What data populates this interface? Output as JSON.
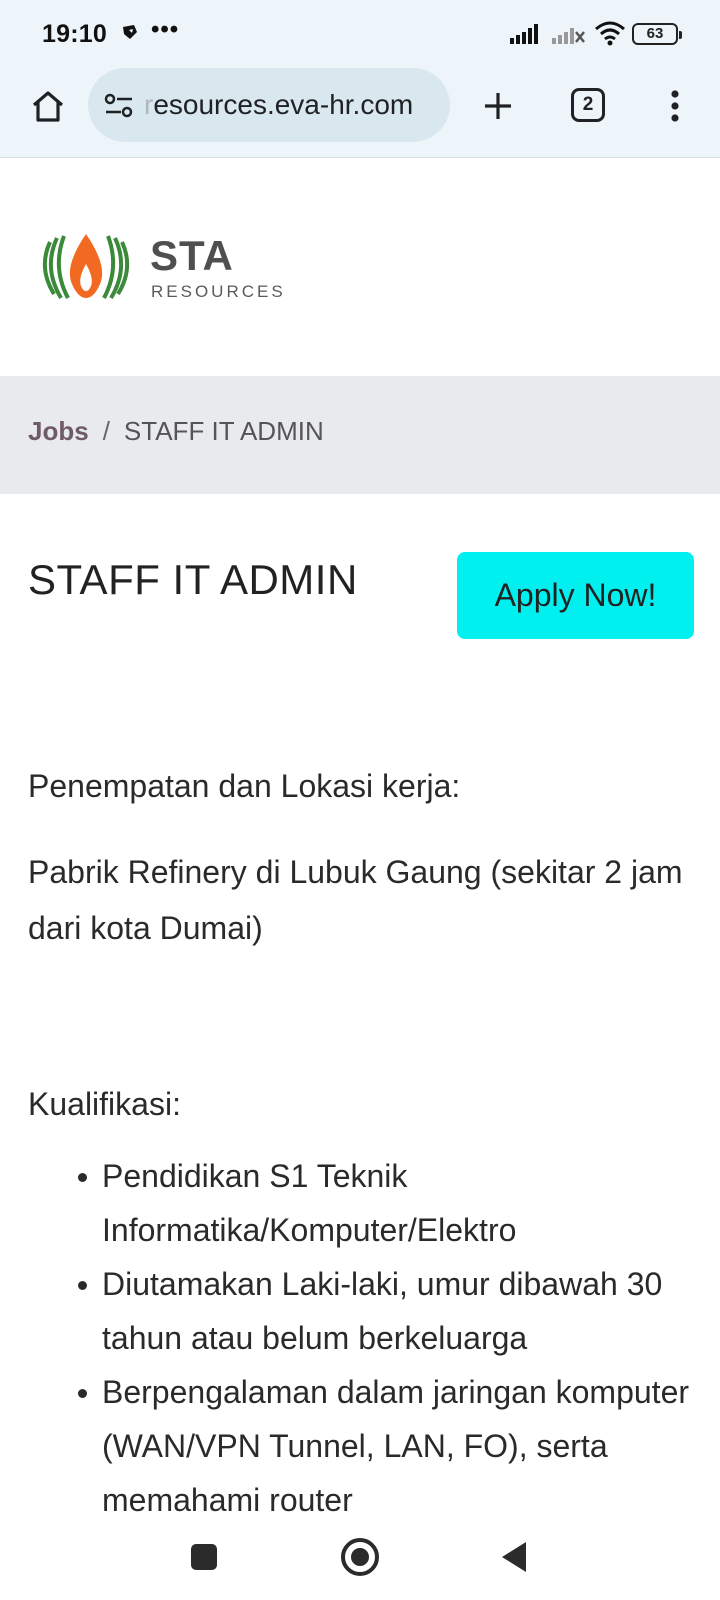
{
  "status_bar": {
    "time": "19:10",
    "more": "•••",
    "battery": "63"
  },
  "browser": {
    "url_fade": "r",
    "url_rest": "esources.eva-hr.com",
    "tab_count": "2"
  },
  "site": {
    "logo_name": "STA",
    "logo_sub": "RESOURCES",
    "logo_colors": {
      "leaf": "#3a8a3a",
      "flame": "#f26a21"
    }
  },
  "breadcrumb": {
    "jobs": "Jobs",
    "separator": "/",
    "current": "STAFF IT ADMIN"
  },
  "job": {
    "title": "STAFF IT ADMIN",
    "apply_label": "Apply Now!",
    "apply_color": "#00f0f0",
    "placement_label": "Penempatan dan Lokasi kerja:",
    "placement_text": "Pabrik Refinery di Lubuk Gaung (sekitar 2 jam dari kota Dumai)",
    "qualification_label": "Kualifikasi:",
    "qualifications": [
      "Pendidikan S1 Teknik Informatika/Komputer/Elektro",
      "Diutamakan Laki-laki, umur dibawah 30 tahun atau belum berkeluarga",
      "Berpengalaman dalam jaringan komputer (WAN/VPN Tunnel, LAN, FO), serta memahami router"
    ]
  }
}
